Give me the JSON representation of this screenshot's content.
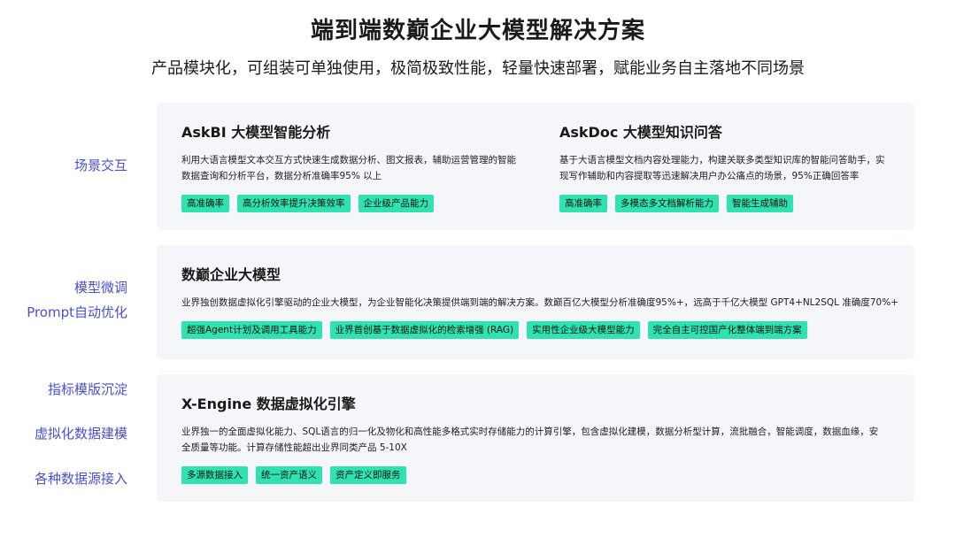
{
  "header": {
    "title": "端到端数巅企业大模型解决方案",
    "subtitle": "产品模块化，可组装可单独使用，极简极致性能，轻量快速部署，赋能业务自主落地不同场景"
  },
  "side_labels": {
    "scene": "场景交互",
    "model_tune": "模型微调",
    "prompt": "Prompt自动优化",
    "metric": "指标模版沉淀",
    "virtual_model": "虚拟化数据建模",
    "datasource": "各种数据源接入"
  },
  "askbi": {
    "title": "AskBI 大模型智能分析",
    "desc": "利用大语言模型文本交互方式快速生成数据分析、图文报表，辅助运营管理的智能数据查询和分析平台，数据分析准确率95% 以上",
    "tags": [
      "高准确率",
      "高分析效率提升决策效率",
      "企业级产品能力"
    ]
  },
  "askdoc": {
    "title": "AskDoc 大模型知识问答",
    "desc": "基于大语言模型文档内容处理能力，构建关联多类型知识库的智能问答助手，实现写作辅助和内容提取等迅速解决用户办公痛点的场景，95%正确回答率",
    "tags": [
      "高准确率",
      "多模态多文档解析能力",
      "智能生成辅助"
    ]
  },
  "llm": {
    "title": "数巅企业大模型",
    "desc": "业界独创数据虚拟化引擎驱动的企业大模型，为企业智能化决策提供端到端的解决方案。数巅百亿大模型分析准确度95%+，远高于千亿大模型 GPT4+NL2SQL 准确度70%+",
    "tags": [
      "超强Agent计划及调用工具能力",
      "业界首创基于数据虚拟化的检索增强 (RAG)",
      "实用性企业级大模型能力",
      "完全自主可控国产化整体端到端方案"
    ]
  },
  "xengine": {
    "title": "X-Engine 数据虚拟化引擎",
    "desc": "业界独一的全面虚拟化能力、SQL语言的归一化及物化和高性能多格式实时存储能力的计算引擎，包含虚拟化建模，数据分析型计算，流批融合，智能调度，数据血缘，安全质量等功能。计算存储性能超出业界同类产品 5-10X",
    "tags": [
      "多源数据接入",
      "统一资产语义",
      "资产定义即服务"
    ]
  },
  "colors": {
    "accent": "#4a4fd1",
    "tag_bg": "#2ee3b0",
    "card_bg": "#f5f6fa"
  }
}
